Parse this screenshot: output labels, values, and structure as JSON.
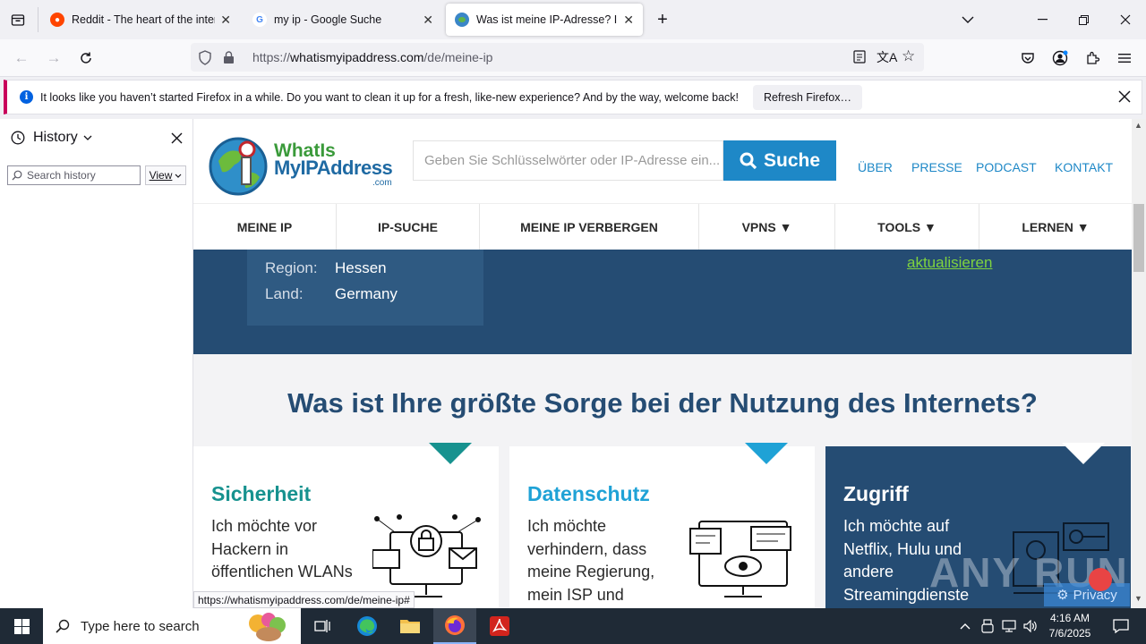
{
  "tabs": [
    {
      "title": "Reddit - The heart of the internet",
      "close": "✕"
    },
    {
      "title": "my ip - Google Suche",
      "close": "✕"
    },
    {
      "title": "Was ist meine IP-Adresse? IP-Adresse",
      "close": "✕"
    }
  ],
  "url": {
    "prefix": "https://",
    "host": "whatismyipaddress.com",
    "path": "/de/meine-ip"
  },
  "notification": {
    "message": "It looks like you haven’t started Firefox in a while. Do you want to clean it up for a fresh, like-new experience? And by the way, welcome back!",
    "button": "Refresh Firefox…"
  },
  "sidebar": {
    "title": "History",
    "search_placeholder": "Search history",
    "view": "View"
  },
  "site": {
    "logo_line1": "WhatIs",
    "logo_line2": "MyIPAddress",
    "logo_line3": ".com",
    "search_placeholder": "Geben Sie Schlüsselwörter oder IP-Adresse ein...",
    "search_button": "Suche",
    "top_links": [
      "ÜBER",
      "PRESSE",
      "PODCAST",
      "KONTAKT"
    ],
    "nav": [
      "MEINE IP",
      "IP-SUCHE",
      "MEINE IP VERBERGEN",
      "VPNS ▼",
      "TOOLS ▼",
      "LERNEN ▼"
    ],
    "info": {
      "region_label": "Region:",
      "region_value": "Hessen",
      "country_label": "Land:",
      "country_value": "Germany"
    },
    "refresh_link": "aktualisieren",
    "question": "Was ist Ihre größte Sorge bei der Nutzung des Internets?",
    "cards": [
      {
        "title": "Sicherheit",
        "text": "Ich möchte vor Hackern in öffentlichen WLANs",
        "color": "#17928f"
      },
      {
        "title": "Datenschutz",
        "text": "Ich möchte verhindern, dass meine Regierung, mein ISP und",
        "color": "#1fa2d6"
      },
      {
        "title": "Zugriff",
        "text": "Ich möchte auf Netflix, Hulu und andere Streamingdienste",
        "color": "#ffffff"
      }
    ],
    "privacy": "Privacy"
  },
  "status_url": "https://whatismyipaddress.com/de/meine-ip#",
  "taskbar": {
    "search_placeholder": "Type here to search",
    "time": "4:16 AM",
    "date": "7/6/2025"
  },
  "watermark": "ANY RUN"
}
